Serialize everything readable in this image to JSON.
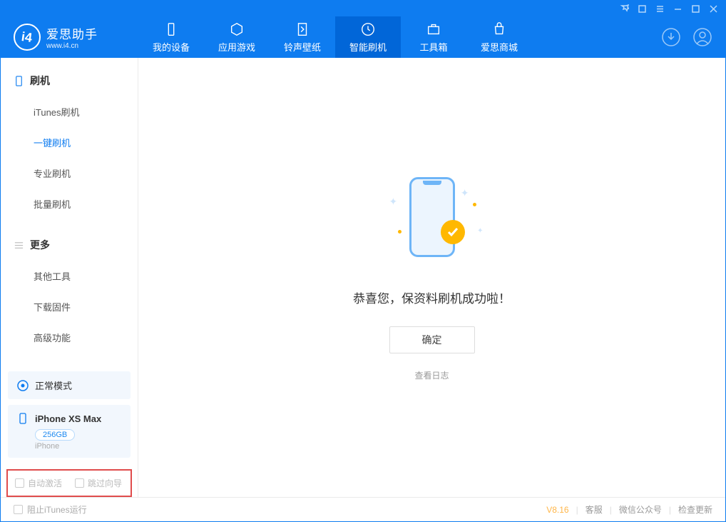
{
  "app": {
    "title": "爱思助手",
    "subtitle": "www.i4.cn"
  },
  "nav": {
    "items": [
      {
        "label": "我的设备"
      },
      {
        "label": "应用游戏"
      },
      {
        "label": "铃声壁纸"
      },
      {
        "label": "智能刷机"
      },
      {
        "label": "工具箱"
      },
      {
        "label": "爱思商城"
      }
    ]
  },
  "sidebar": {
    "section1": {
      "title": "刷机",
      "items": [
        "iTunes刷机",
        "一键刷机",
        "专业刷机",
        "批量刷机"
      ]
    },
    "section2": {
      "title": "更多",
      "items": [
        "其他工具",
        "下载固件",
        "高级功能"
      ]
    },
    "mode": "正常模式",
    "device": {
      "name": "iPhone XS Max",
      "capacity": "256GB",
      "type": "iPhone"
    },
    "checks": {
      "auto_activate": "自动激活",
      "skip_guide": "跳过向导"
    }
  },
  "main": {
    "success_text": "恭喜您，保资料刷机成功啦！",
    "ok_label": "确定",
    "log_link": "查看日志"
  },
  "footer": {
    "block_itunes": "阻止iTunes运行",
    "version": "V8.16",
    "links": [
      "客服",
      "微信公众号",
      "检查更新"
    ]
  }
}
